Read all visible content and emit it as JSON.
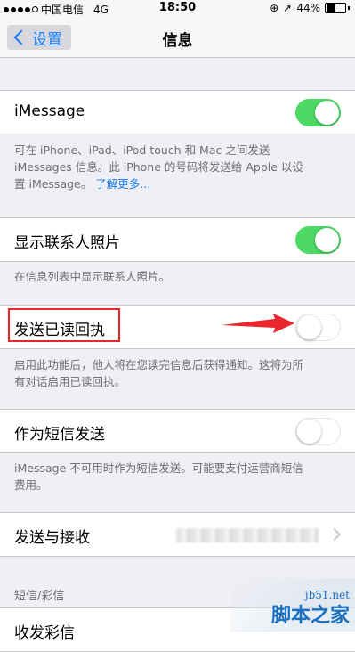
{
  "status_bar": {
    "carrier": "中国电信",
    "network": "4G",
    "time": "18:50",
    "battery": "44%",
    "battery_level": 0.44
  },
  "nav": {
    "back_label": "设置",
    "title": "信息"
  },
  "imessage": {
    "label": "iMessage",
    "enabled": true,
    "footer_line1": "可在 iPhone、iPad、iPod touch 和 Mac 之间发送",
    "footer_line2": "iMessages 信息。此 iPhone 的号码将发送给 Apple 以设",
    "footer_line3": "置 iMessage。",
    "footer_link": "了解更多..."
  },
  "contact_photos": {
    "label": "显示联系人照片",
    "enabled": true,
    "footer": "在信息列表中显示联系人照片。"
  },
  "read_receipts": {
    "label": "发送已读回执",
    "enabled": false,
    "footer_line1": "启用此功能后，他人将在您读完信息后获得通知。这将为所",
    "footer_line2": "有对话启用已读回执。"
  },
  "send_as_sms": {
    "label": "作为短信发送",
    "enabled": false,
    "footer_line1": "iMessage 不可用时作为短信发送。可能要支付运营商短信",
    "footer_line2": "费用。"
  },
  "send_receive": {
    "label": "发送与接收"
  },
  "sms_mms": {
    "header": "短信/彩信",
    "next_item": "收发彩信"
  },
  "watermark": {
    "site": "jb51.net",
    "name": "脚本之家"
  },
  "colors": {
    "toggle_on": "#4cd964",
    "link": "#157efb",
    "annotation": "#e8262b"
  }
}
